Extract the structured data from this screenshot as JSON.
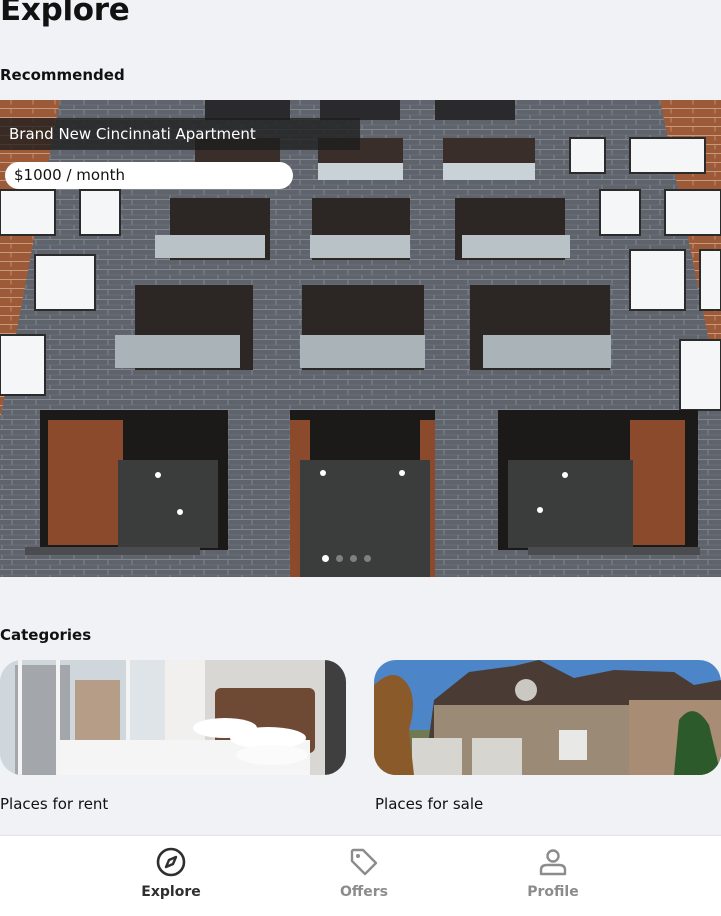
{
  "page": {
    "title": "Explore"
  },
  "recommended": {
    "heading": "Recommended",
    "listing": {
      "title": "Brand New Cincinnati Apartment",
      "price": "$1000 / month"
    },
    "carousel": {
      "total": 4,
      "active_index": 0
    }
  },
  "categories": {
    "heading": "Categories",
    "items": [
      {
        "label": "Places for rent"
      },
      {
        "label": "Places for sale"
      }
    ]
  },
  "tab_bar": {
    "tabs": [
      {
        "label": "Explore",
        "icon": "compass-icon",
        "active": true
      },
      {
        "label": "Offers",
        "icon": "tag-icon",
        "active": false
      },
      {
        "label": "Profile",
        "icon": "user-icon",
        "active": false
      }
    ]
  },
  "colors": {
    "background": "#f1f2f6",
    "active_tab": "#2f2f2f",
    "inactive_tab": "#8c8c8c"
  }
}
